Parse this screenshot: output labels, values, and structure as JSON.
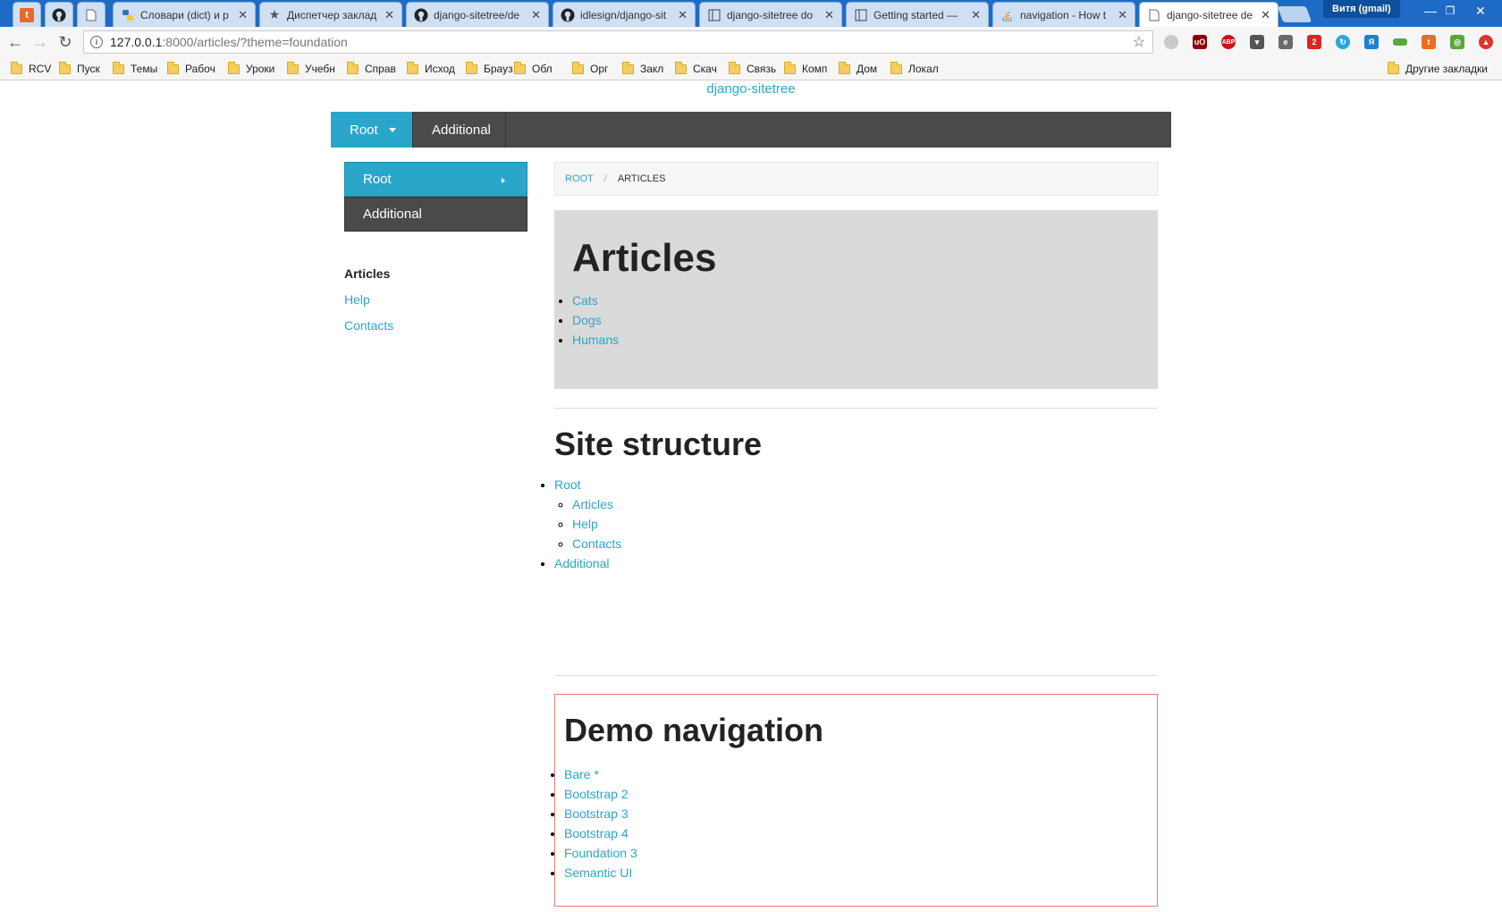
{
  "browser": {
    "tabs": [
      {
        "title": "",
        "icon": "t-app-icon"
      },
      {
        "title": "",
        "icon": "github-icon"
      },
      {
        "title": "",
        "icon": "page-icon"
      },
      {
        "title": "Словари (dict) и р",
        "icon": "python-icon"
      },
      {
        "title": "Диспетчер заклад",
        "icon": "star-icon"
      },
      {
        "title": "django-sitetree/de",
        "icon": "github-icon"
      },
      {
        "title": "idlesign/django-sit",
        "icon": "github-icon"
      },
      {
        "title": "django-sitetree do",
        "icon": "docs-icon"
      },
      {
        "title": "Getting started — ",
        "icon": "docs-icon"
      },
      {
        "title": "navigation - How t",
        "icon": "stackoverflow-icon"
      },
      {
        "title": "django-sitetree de",
        "icon": "page-icon"
      }
    ],
    "profile": "Витя (gmail)",
    "url_host": "127.0.0.1",
    "url_path": ":8000/articles/?theme=foundation",
    "bookmarks": [
      "RCV",
      "Пуск",
      "Темы",
      "Рабоч",
      "Уроки",
      "Учебн",
      "Справ",
      "Исход",
      "Брауз",
      "Обл",
      "Орг",
      "Закл",
      "Скач",
      "Связь",
      "Комп",
      "Дом",
      "Локал"
    ],
    "other_bookmarks": "Другие закладки"
  },
  "page": {
    "site_title": "django-sitetree",
    "topbar": {
      "root": "Root",
      "additional": "Additional"
    },
    "sidenav": {
      "root": "Root",
      "additional": "Additional"
    },
    "sublist": [
      "Articles",
      "Help",
      "Contacts"
    ],
    "breadcrumb": {
      "root": "Root",
      "current": "Articles"
    },
    "articles_title": "Articles",
    "articles": [
      "Cats",
      "Dogs",
      "Humans"
    ],
    "structure_title": "Site structure",
    "structure": {
      "root": "Root",
      "children": [
        "Articles",
        "Help",
        "Contacts"
      ],
      "additional": "Additional"
    },
    "demo_title": "Demo navigation",
    "demo_links": [
      "Bare *",
      "Bootstrap 2",
      "Bootstrap 3",
      "Bootstrap 4",
      "Foundation 3",
      "Semantic UI"
    ]
  },
  "colors": {
    "accent": "#2ba6cb",
    "dark": "#4a4a4a",
    "chrome_blue": "#1e6bc6",
    "demo_border": "#e07a7a"
  }
}
